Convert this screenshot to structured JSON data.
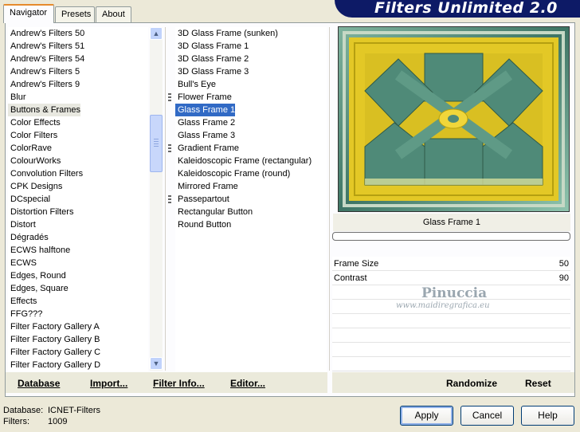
{
  "tabs": [
    {
      "label": "Navigator"
    },
    {
      "label": "Presets"
    },
    {
      "label": "About"
    }
  ],
  "app_title": "Filters Unlimited 2.0",
  "categories": [
    "Andrew's Filters 50",
    "Andrew's Filters 51",
    "Andrew's Filters 54",
    "Andrew's Filters 5",
    "Andrew's Filters 9",
    "Blur",
    "Buttons & Frames",
    "Color Effects",
    "Color Filters",
    "ColorRave",
    "ColourWorks",
    "Convolution Filters",
    "CPK Designs",
    "DCspecial",
    "Distortion Filters",
    "Distort",
    "Dégradés",
    "ECWS halftone",
    "ECWS",
    "Edges, Round",
    "Edges, Square",
    "Effects",
    "FFG???",
    "Filter Factory Gallery A",
    "Filter Factory Gallery B",
    "Filter Factory Gallery C",
    "Filter Factory Gallery D"
  ],
  "selected_category": "Buttons & Frames",
  "filters": [
    {
      "label": "3D Glass Frame (sunken)",
      "group": false
    },
    {
      "label": "3D Glass Frame 1",
      "group": false
    },
    {
      "label": "3D Glass Frame 2",
      "group": false
    },
    {
      "label": "3D Glass Frame 3",
      "group": false
    },
    {
      "label": "Bull's Eye",
      "group": false
    },
    {
      "label": "Flower Frame",
      "group": true
    },
    {
      "label": "Glass Frame 1",
      "group": false
    },
    {
      "label": "Glass Frame 2",
      "group": false
    },
    {
      "label": "Glass Frame 3",
      "group": false
    },
    {
      "label": "Gradient Frame",
      "group": true
    },
    {
      "label": "Kaleidoscopic Frame (rectangular)",
      "group": false
    },
    {
      "label": "Kaleidoscopic Frame (round)",
      "group": false
    },
    {
      "label": "Mirrored Frame",
      "group": false
    },
    {
      "label": "Passepartout",
      "group": true
    },
    {
      "label": "Rectangular Button",
      "group": false
    },
    {
      "label": "Round Button",
      "group": false
    }
  ],
  "selected_filter": "Glass Frame 1",
  "preview": {
    "caption": "Glass Frame 1",
    "progress": 0
  },
  "params": [
    {
      "label": "Frame Size",
      "value": "50"
    },
    {
      "label": "Contrast",
      "value": "90"
    }
  ],
  "watermark": {
    "line1": "Pinuccia",
    "line2": "www.maidiregrafica.eu"
  },
  "bottom_left": {
    "database": "Database",
    "import": "Import...",
    "info": "Filter Info...",
    "editor": "Editor..."
  },
  "bottom_right": {
    "randomize": "Randomize",
    "reset": "Reset"
  },
  "status": {
    "db_label": "Database:",
    "db_value": "ICNET-Filters",
    "filters_label": "Filters:",
    "filters_value": "1009"
  },
  "buttons": {
    "apply": "Apply",
    "cancel": "Cancel",
    "help": "Help"
  },
  "colors": {
    "selection": "#316ac5",
    "preview_yellow": "#e3c826",
    "preview_teal": "#4f8a78",
    "title_bar": "#0d1a66"
  }
}
